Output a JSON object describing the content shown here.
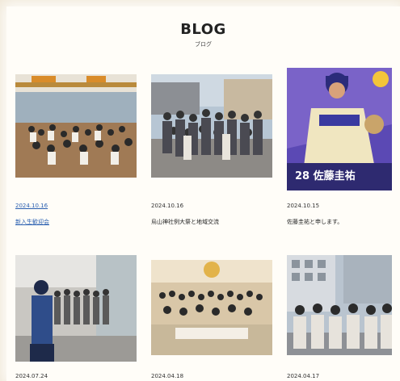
{
  "header": {
    "title": "BLOG",
    "subtitle": "ブログ"
  },
  "posts": [
    {
      "date": "2024.10.16",
      "title": "新入生歓迎会"
    },
    {
      "date": "2024.10.16",
      "title": "烏山神社例大祭と地域交流"
    },
    {
      "date": "2024.10.15",
      "title": "佐藤圭祐と申します。",
      "overlay_text": "28 佐藤圭祐"
    },
    {
      "date": "2024.07.24",
      "title": ""
    },
    {
      "date": "2024.04.18",
      "title": ""
    },
    {
      "date": "2024.04.17",
      "title": ""
    }
  ],
  "colors": {
    "link": "#2a5fb0",
    "background": "#efe6d4",
    "card_purple": "#4a3aa8"
  }
}
